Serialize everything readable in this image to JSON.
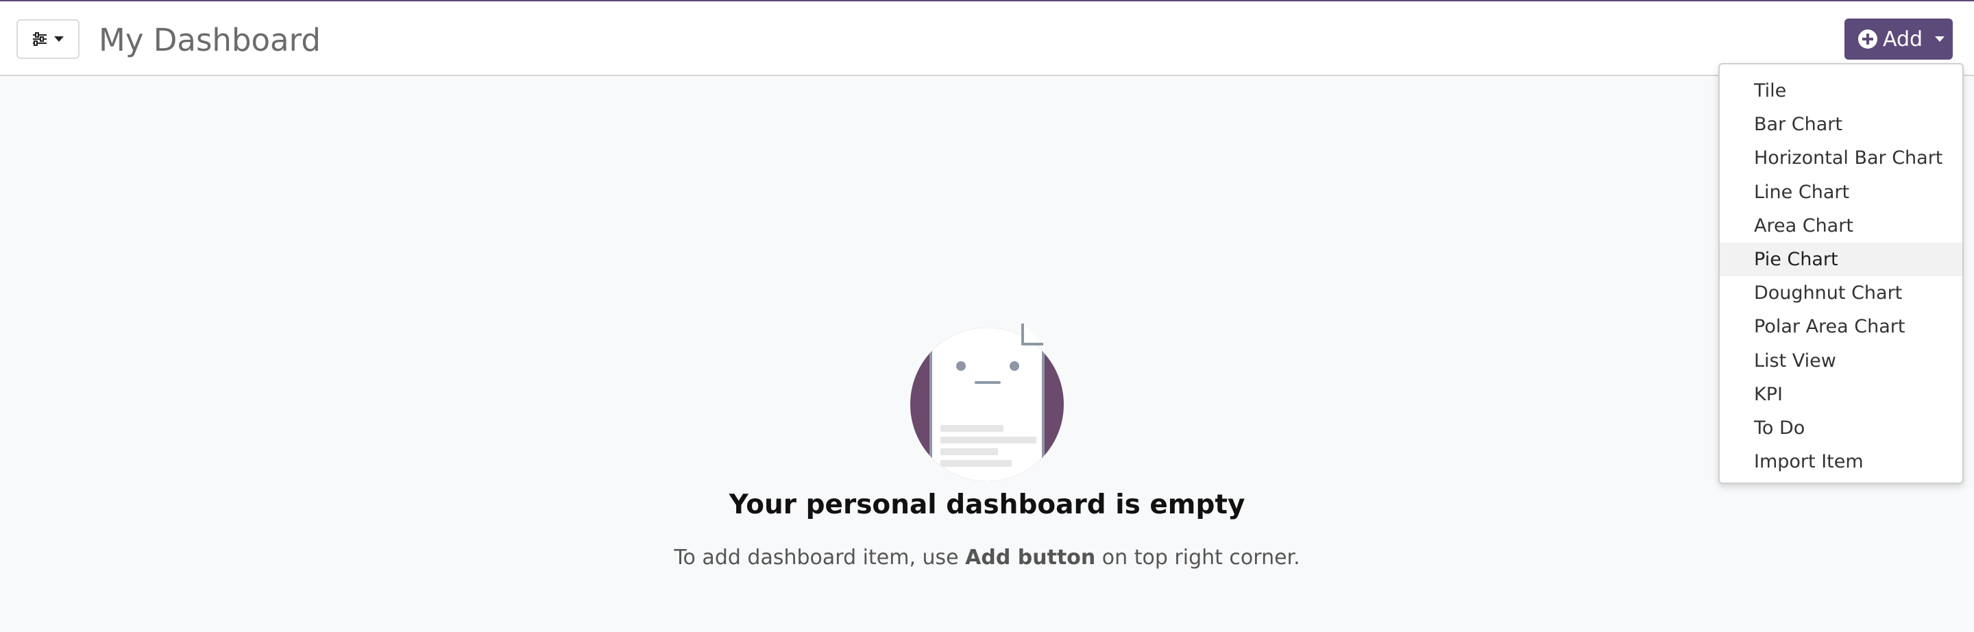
{
  "header": {
    "title": "My Dashboard",
    "filter_icon": "sliders-icon",
    "add_label": "Add",
    "add_icon": "plus-circle-icon"
  },
  "add_menu": {
    "items": [
      {
        "label": "Tile"
      },
      {
        "label": "Bar Chart"
      },
      {
        "label": "Horizontal Bar Chart"
      },
      {
        "label": "Line Chart"
      },
      {
        "label": "Area Chart"
      },
      {
        "label": "Pie Chart",
        "hovered": true
      },
      {
        "label": "Doughnut Chart"
      },
      {
        "label": "Polar Area Chart"
      },
      {
        "label": "List View"
      },
      {
        "label": "KPI"
      },
      {
        "label": "To Do"
      },
      {
        "label": "Import Item"
      }
    ]
  },
  "empty_state": {
    "illustration_icon": "empty-document-icon",
    "title": "Your personal dashboard is empty",
    "hint_prefix": "To add dashboard item, use ",
    "hint_bold": "Add button",
    "hint_suffix": " on top right corner."
  },
  "colors": {
    "accent": "#5c4a7a",
    "illustration_circle": "#6b4a6e",
    "background": "#f8f9fa"
  }
}
